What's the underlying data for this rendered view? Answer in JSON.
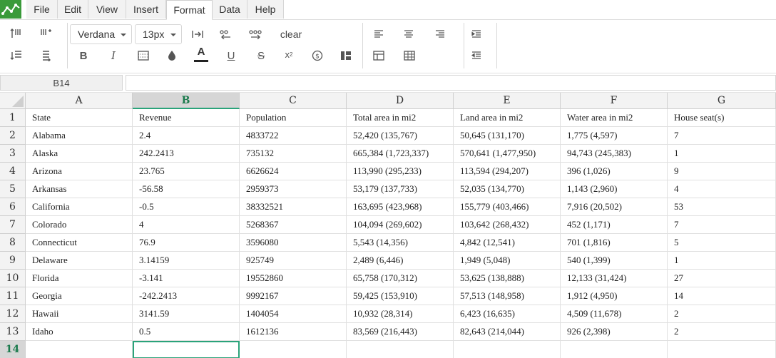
{
  "menu": {
    "items": [
      "File",
      "Edit",
      "View",
      "Insert",
      "Format",
      "Data",
      "Help"
    ],
    "active": "Format"
  },
  "toolbar": {
    "font_family": "Verdana",
    "font_size": "13px",
    "clear_label": "clear"
  },
  "formula_bar": {
    "name_box": "B14",
    "formula": ""
  },
  "grid": {
    "columns": [
      "A",
      "B",
      "C",
      "D",
      "E",
      "F",
      "G"
    ],
    "selected_column": "B",
    "selected_row": "14",
    "active_cell": "B14",
    "row_numbers": [
      "1",
      "2",
      "3",
      "4",
      "5",
      "6",
      "7",
      "8",
      "9",
      "10",
      "11",
      "12",
      "13",
      "14"
    ],
    "rows": [
      [
        "State",
        "Revenue",
        "Population",
        "Total area in mi2",
        "Land area in mi2",
        "Water area in mi2",
        "House seat(s)"
      ],
      [
        "Alabama",
        "2.4",
        "4833722",
        "52,420 (135,767)",
        "50,645 (131,170)",
        "1,775 (4,597)",
        "7"
      ],
      [
        "Alaska",
        "242.2413",
        "735132",
        "665,384 (1,723,337)",
        "570,641 (1,477,950)",
        "94,743 (245,383)",
        "1"
      ],
      [
        "Arizona",
        "23.765",
        "6626624",
        "113,990 (295,233)",
        "113,594 (294,207)",
        "396 (1,026)",
        "9"
      ],
      [
        "Arkansas",
        "-56.58",
        "2959373",
        "53,179 (137,733)",
        "52,035 (134,770)",
        "1,143 (2,960)",
        "4"
      ],
      [
        "California",
        "-0.5",
        "38332521",
        "163,695 (423,968)",
        "155,779 (403,466)",
        "7,916 (20,502)",
        "53"
      ],
      [
        "Colorado",
        "4",
        "5268367",
        "104,094 (269,602)",
        "103,642 (268,432)",
        "452 (1,171)",
        "7"
      ],
      [
        "Connecticut",
        "76.9",
        "3596080",
        "5,543 (14,356)",
        "4,842 (12,541)",
        "701 (1,816)",
        "5"
      ],
      [
        "Delaware",
        "3.14159",
        "925749",
        "2,489 (6,446)",
        "1,949 (5,048)",
        "540 (1,399)",
        "1"
      ],
      [
        "Florida",
        "-3.141",
        "19552860",
        "65,758 (170,312)",
        "53,625 (138,888)",
        "12,133 (31,424)",
        "27"
      ],
      [
        "Georgia",
        "-242.2413",
        "9992167",
        "59,425 (153,910)",
        "57,513 (148,958)",
        "1,912 (4,950)",
        "14"
      ],
      [
        "Hawaii",
        "3141.59",
        "1404054",
        "10,932 (28,314)",
        "6,423 (16,635)",
        "4,509 (11,678)",
        "2"
      ],
      [
        "Idaho",
        "0.5",
        "1612136",
        "83,569 (216,443)",
        "82,643 (214,044)",
        "926 (2,398)",
        "2"
      ],
      [
        "",
        "",
        "",
        "",
        "",
        "",
        ""
      ]
    ]
  },
  "colors": {
    "accent": "#2aa37a",
    "logo": "#3a9a3a",
    "header_bg": "#f3f3f3",
    "selected_header_bg": "#d6d6d6"
  }
}
